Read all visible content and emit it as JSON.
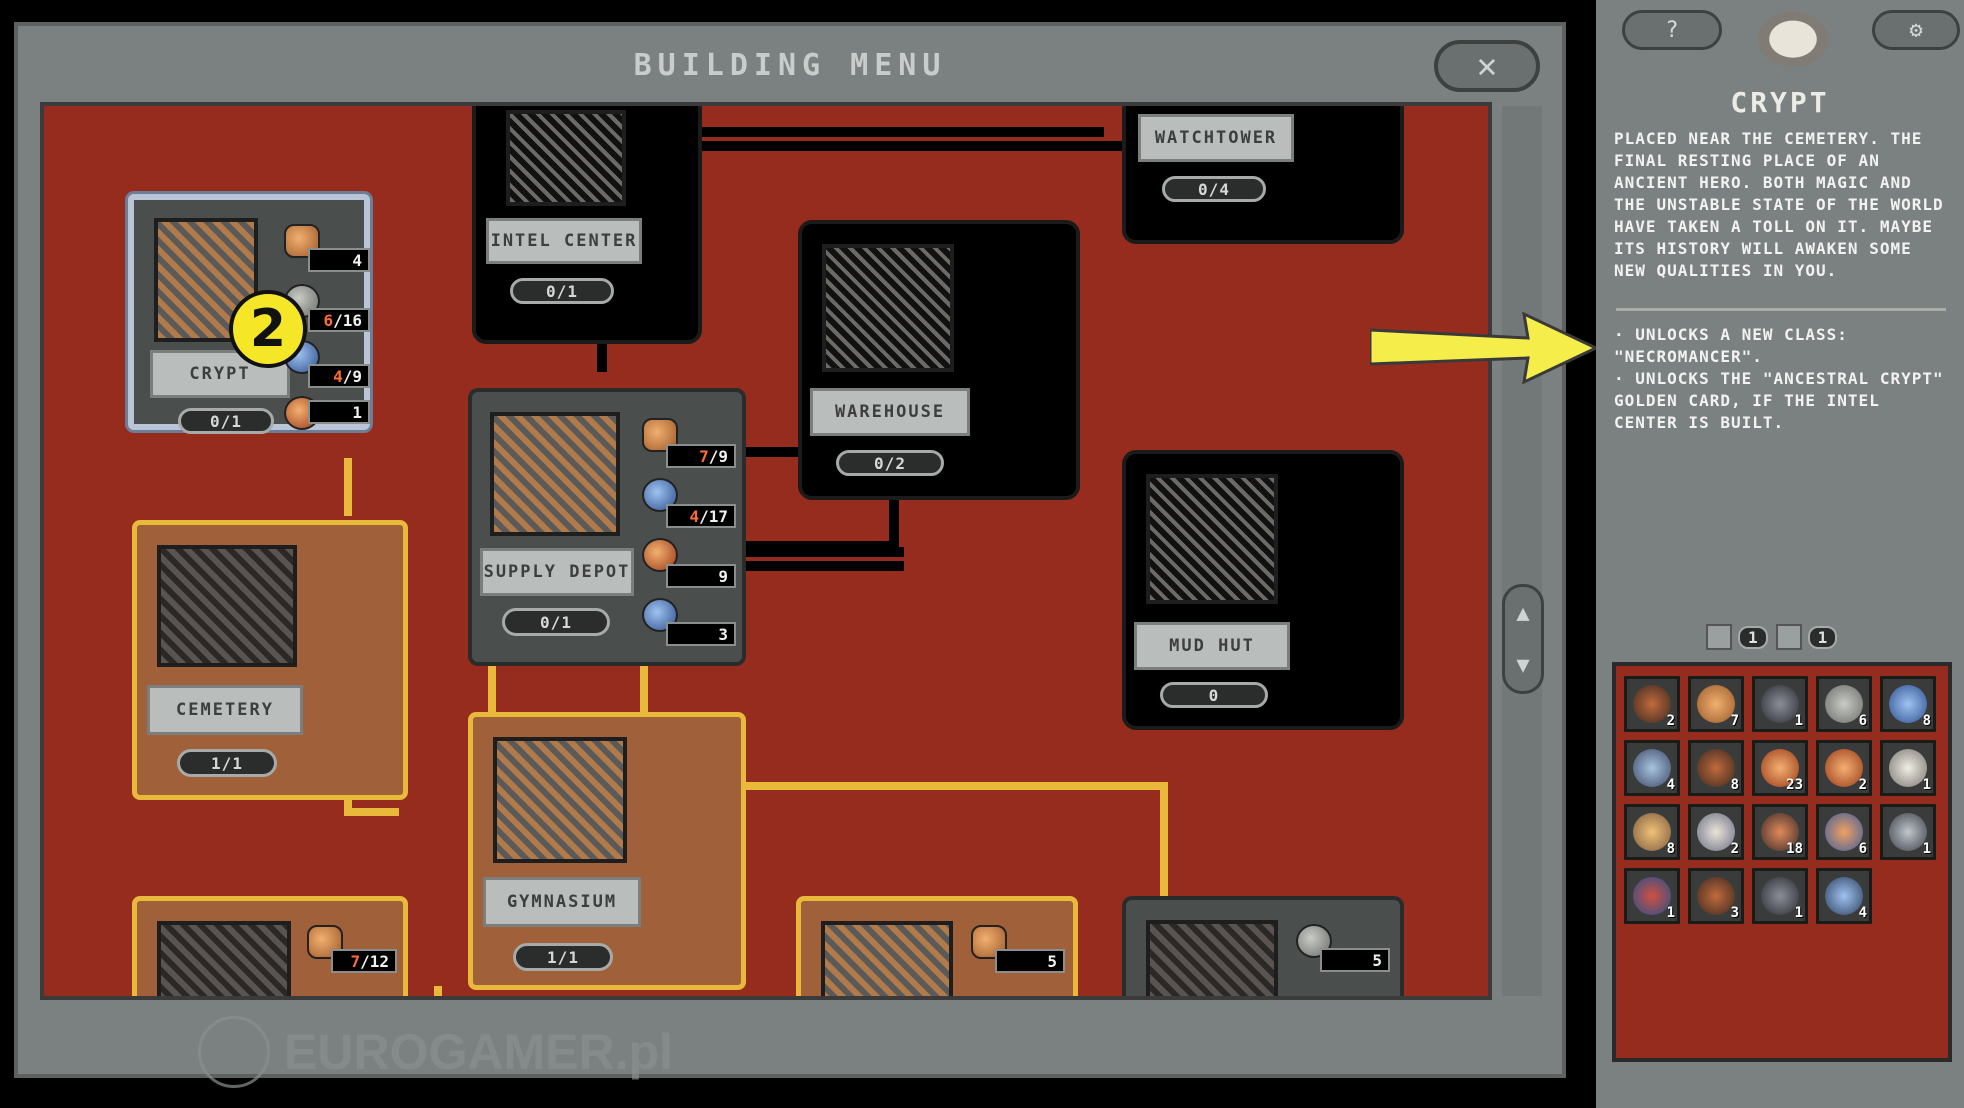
{
  "window": {
    "title": "BUILDING MENU",
    "close_label": "✕"
  },
  "buildings": {
    "crypt": {
      "name": "CRYPT",
      "count": "0/1",
      "resources": [
        {
          "icon": "wood-icon",
          "kind": "wood",
          "value": "4",
          "have": "",
          "need": ""
        },
        {
          "icon": "stone-icon",
          "kind": "stone",
          "value": "",
          "have": "6",
          "need": "/16"
        },
        {
          "icon": "blue-orb-icon",
          "kind": "orb-blue",
          "value": "",
          "have": "4",
          "need": "/9"
        },
        {
          "icon": "orange-orb-icon",
          "kind": "orb-orange",
          "value": "1",
          "have": "",
          "need": ""
        }
      ]
    },
    "intel_center": {
      "name": "INTEL CENTER",
      "count": "0/1"
    },
    "watchtower": {
      "name": "WATCHTOWER",
      "count": "0/4"
    },
    "warehouse": {
      "name": "WAREHOUSE",
      "count": "0/2"
    },
    "supply_depot": {
      "name": "SUPPLY DEPOT",
      "count": "0/1",
      "resources": [
        {
          "icon": "wood-icon",
          "kind": "wood",
          "value": "",
          "have": "7",
          "need": "/9"
        },
        {
          "icon": "blue-orb-icon",
          "kind": "orb-blue",
          "value": "",
          "have": "4",
          "need": "/17"
        },
        {
          "icon": "orange-orb-icon",
          "kind": "orb-orange",
          "value": "9",
          "have": "",
          "need": ""
        },
        {
          "icon": "blue-orange-orb-icon",
          "kind": "orb-blue",
          "value": "3",
          "have": "",
          "need": ""
        }
      ]
    },
    "mud_hut": {
      "name": "MUD HUT",
      "count": "0"
    },
    "cemetery": {
      "name": "CEMETERY",
      "count": "1/1"
    },
    "gymnasium": {
      "name": "GYMNASIUM",
      "count": "1/1"
    },
    "bottom_left": {
      "resource_have": "7",
      "resource_need": "/12"
    },
    "bottom_mid": {
      "resource_value": "5"
    },
    "bottom_right": {
      "resource_value": "5"
    }
  },
  "annotation": {
    "step_number": "2"
  },
  "watermark": {
    "text": "EUROGAMER.pl"
  },
  "side_panel": {
    "help_label": "?",
    "settings_label": "⚙",
    "title": "CRYPT",
    "description": "PLACED NEAR THE CEMETERY. THE FINAL RESTING PLACE OF AN ANCIENT HERO. BOTH MAGIC AND THE UNSTABLE STATE OF THE WORLD HAVE TAKEN A TOLL ON IT. MAYBE ITS HISTORY WILL AWAKEN SOME NEW QUALITIES IN YOU.",
    "bullets": [
      "· UNLOCKS A NEW CLASS: \"NECROMANCER\".",
      "· UNLOCKS THE \"ANCESTRAL CRYPT\" GOLDEN CARD, IF THE INTEL CENTER IS BUILT."
    ],
    "inventory_counts": [
      "1",
      "1"
    ],
    "inventory": [
      {
        "icon": "branch-icon",
        "qty": "2"
      },
      {
        "icon": "wood-icon",
        "qty": "7"
      },
      {
        "icon": "dark-orb-icon",
        "qty": "1"
      },
      {
        "icon": "stone-icon",
        "qty": "6"
      },
      {
        "icon": "blue-orb-icon",
        "qty": "8"
      },
      {
        "icon": "skull-orb-icon",
        "qty": "4"
      },
      {
        "icon": "branch-icon",
        "qty": "8"
      },
      {
        "icon": "orange-orb-icon",
        "qty": "23"
      },
      {
        "icon": "orange-orb-icon",
        "qty": "2"
      },
      {
        "icon": "skull-icon",
        "qty": "1"
      },
      {
        "icon": "scroll-icon",
        "qty": "8"
      },
      {
        "icon": "book-icon",
        "qty": "2"
      },
      {
        "icon": "rune-icon",
        "qty": "18"
      },
      {
        "icon": "blue-orange-orb-icon",
        "qty": "6"
      },
      {
        "icon": "shard-icon",
        "qty": "1"
      },
      {
        "icon": "blue-red-orb-icon",
        "qty": "1"
      },
      {
        "icon": "branch-icon",
        "qty": "3"
      },
      {
        "icon": "dark-orb-icon",
        "qty": "1"
      },
      {
        "icon": "hook-icon",
        "qty": "4"
      }
    ]
  },
  "colors": {
    "canvas_red": "#952c1e",
    "frame_grey": "#7b8180",
    "gold_path": "#e8b93a",
    "badge_yellow": "#f5e628",
    "arrow_fill": "#f5ee4a"
  }
}
